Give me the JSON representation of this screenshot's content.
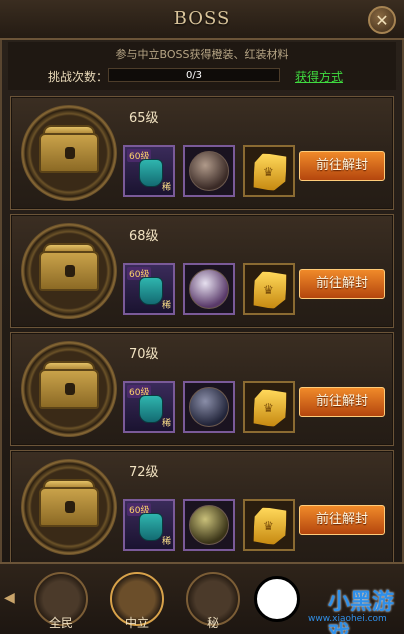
{
  "header": {
    "title": "BOSS",
    "close_icon": "close-icon"
  },
  "info": {
    "description": "参与中立BOSS获得橙装、红装材料",
    "attempts_label": "挑战次数：",
    "progress": {
      "text": "0/3",
      "fraction": 0.0
    },
    "obtain_link": "获得方式"
  },
  "cards": [
    {
      "level": "65级",
      "badge": "60级",
      "tag": "稀",
      "button": "前往解封"
    },
    {
      "level": "68级",
      "badge": "60级",
      "tag": "稀",
      "button": "前往解封"
    },
    {
      "level": "70级",
      "badge": "60级",
      "tag": "稀",
      "button": "前往解封"
    },
    {
      "level": "72级",
      "badge": "60级",
      "tag": "稀",
      "button": "前往解封"
    }
  ],
  "bottom_nav": {
    "items": [
      {
        "label": "全民"
      },
      {
        "label": "中立",
        "active": true
      },
      {
        "label": "秘"
      }
    ]
  },
  "watermark": {
    "brand": "小黑游戏",
    "site": "www.xiaohei.com"
  }
}
